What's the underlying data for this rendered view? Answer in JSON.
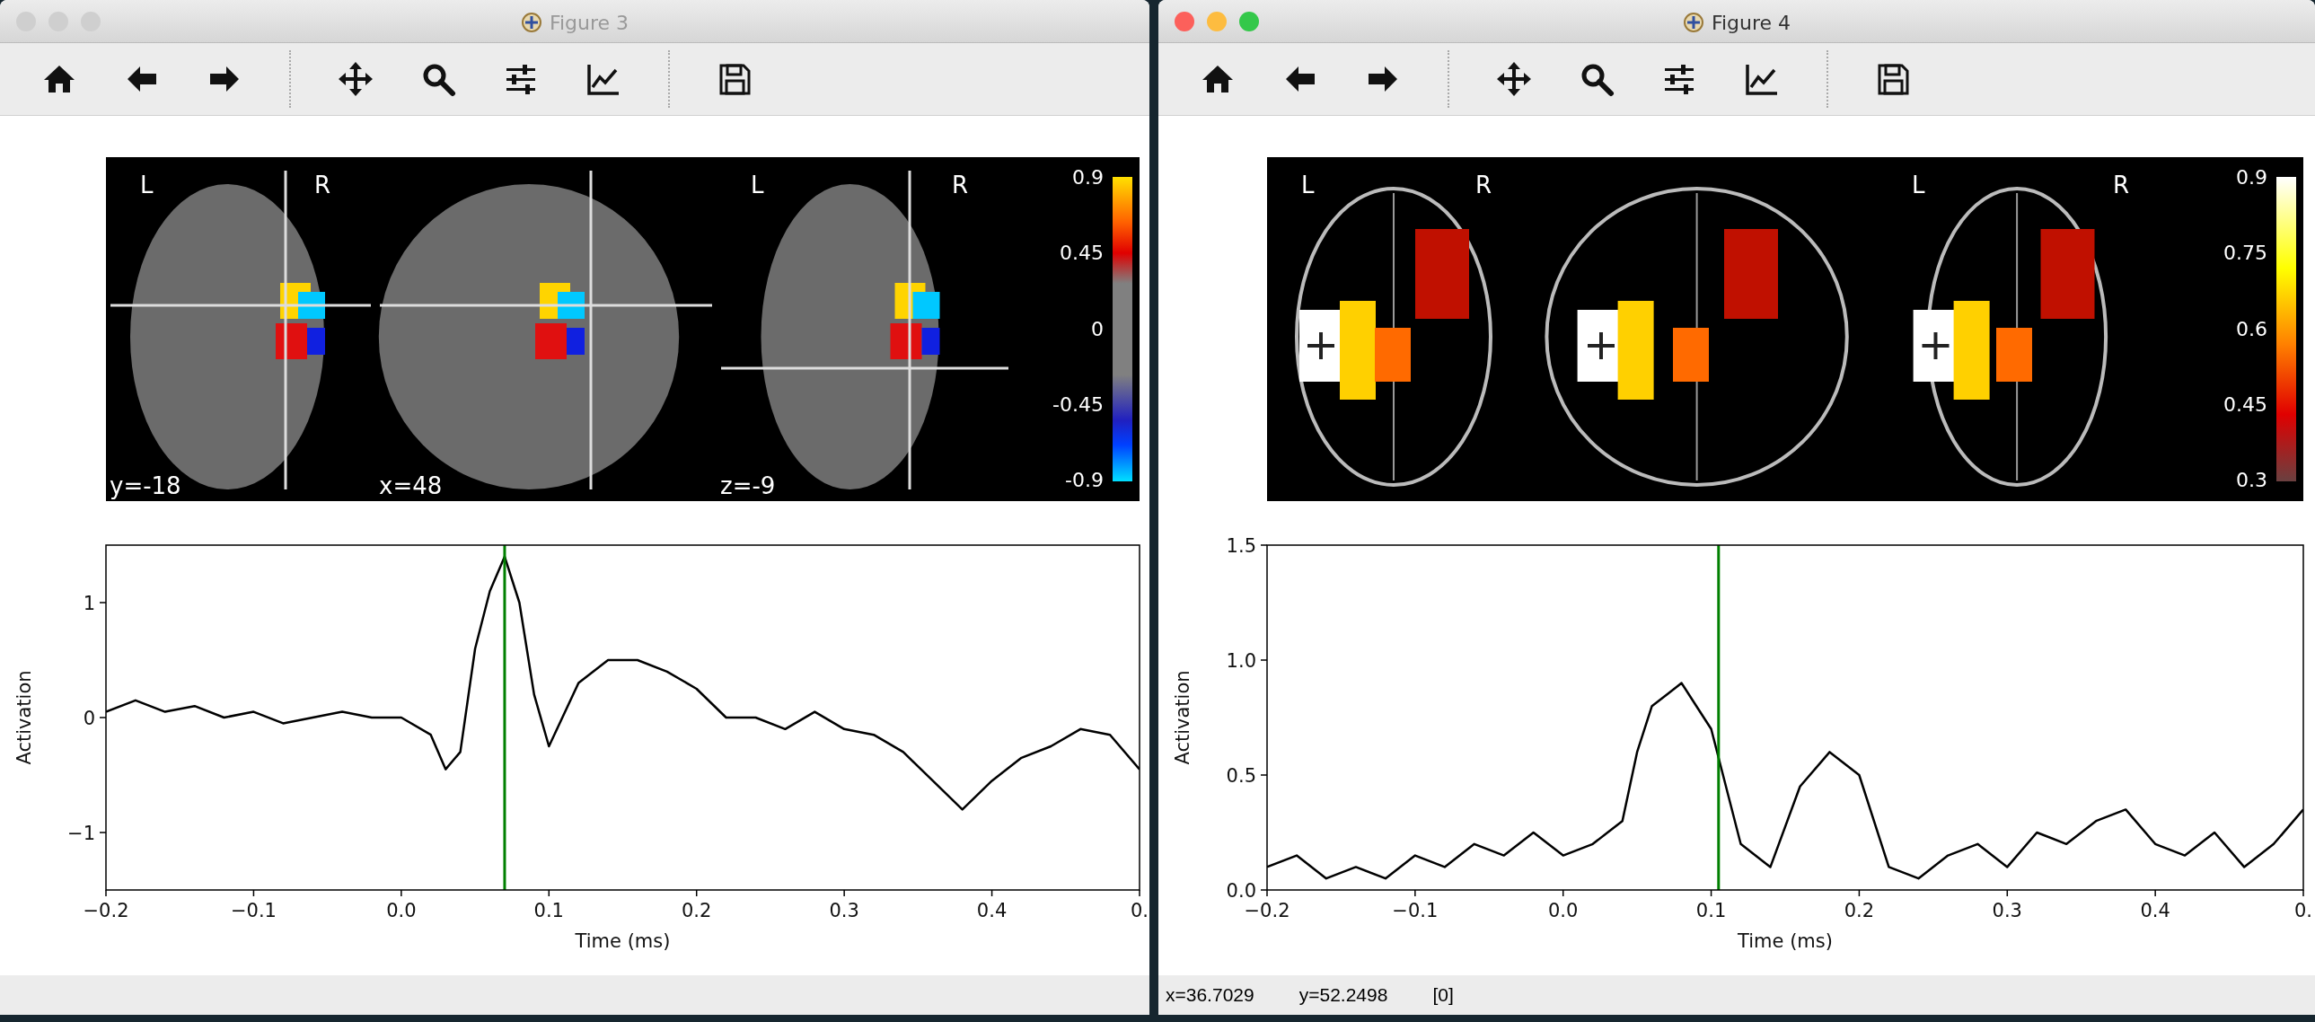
{
  "windows": [
    {
      "title": "Figure 3",
      "active": false,
      "toolbar": [
        {
          "kind": "home"
        },
        {
          "kind": "back"
        },
        {
          "kind": "forward"
        },
        {
          "kind": "separator"
        },
        {
          "kind": "pan"
        },
        {
          "kind": "zoom"
        },
        {
          "kind": "subplots"
        },
        {
          "kind": "axes"
        },
        {
          "kind": "separator"
        },
        {
          "kind": "save"
        }
      ],
      "brain_view": {
        "kind": "slices",
        "views": [
          {
            "kind": "coronal",
            "left": "L",
            "right": "R",
            "coord": "y=-18"
          },
          {
            "kind": "sagittal",
            "coord": "x=48"
          },
          {
            "kind": "axial",
            "left": "L",
            "right": "R",
            "coord": "z=-9"
          }
        ],
        "colorbar_ticks": [
          "0.9",
          "0.45",
          "0",
          "-0.45",
          "-0.9"
        ]
      },
      "plot": {
        "chart_data": {
          "type": "line",
          "xlabel": "Time (ms)",
          "ylabel": "Activation",
          "xlim": [
            -0.2,
            0.5
          ],
          "ylim": [
            -1.5,
            1.5
          ],
          "xticks": [
            {
              "value": -0.2,
              "label": "−0.2"
            },
            {
              "value": -0.1,
              "label": "−0.1"
            },
            {
              "value": 0,
              "label": "0.0"
            },
            {
              "value": 0.1,
              "label": "0.1"
            },
            {
              "value": 0.2,
              "label": "0.2"
            },
            {
              "value": 0.3,
              "label": "0.3"
            },
            {
              "value": 0.4,
              "label": "0.4"
            },
            {
              "value": 0.5,
              "label": "0."
            }
          ],
          "yticks": [
            {
              "value": -1,
              "label": "−1"
            },
            {
              "value": 0,
              "label": "0"
            },
            {
              "value": 1,
              "label": "1"
            }
          ],
          "x": [
            -0.2,
            -0.18,
            -0.16,
            -0.14,
            -0.12,
            -0.1,
            -0.08,
            -0.06,
            -0.04,
            -0.02,
            0,
            0.02,
            0.03,
            0.04,
            0.05,
            0.06,
            0.07,
            0.08,
            0.09,
            0.1,
            0.12,
            0.14,
            0.16,
            0.18,
            0.2,
            0.22,
            0.24,
            0.26,
            0.28,
            0.3,
            0.32,
            0.34,
            0.36,
            0.38,
            0.4,
            0.42,
            0.44,
            0.46,
            0.48,
            0.5
          ],
          "series": [
            {
              "color": "#000000",
              "values": [
                0.05,
                0.15,
                0.05,
                0.1,
                0.0,
                0.05,
                -0.05,
                0.0,
                0.05,
                0.0,
                0.0,
                -0.15,
                -0.45,
                -0.3,
                0.6,
                1.1,
                1.4,
                1.0,
                0.2,
                -0.25,
                0.3,
                0.5,
                0.5,
                0.4,
                0.25,
                0.0,
                0.0,
                -0.1,
                0.05,
                -0.1,
                -0.15,
                -0.3,
                -0.55,
                -0.8,
                -0.55,
                -0.35,
                -0.25,
                -0.1,
                -0.15,
                -0.45
              ]
            }
          ],
          "ref_lines": [
            {
              "axis": "x",
              "value": 0.07,
              "color": "#008000"
            }
          ]
        }
      }
    },
    {
      "title": "Figure 4",
      "active": true,
      "toolbar": [
        {
          "kind": "home"
        },
        {
          "kind": "back"
        },
        {
          "kind": "forward"
        },
        {
          "kind": "separator"
        },
        {
          "kind": "pan"
        },
        {
          "kind": "zoom"
        },
        {
          "kind": "subplots"
        },
        {
          "kind": "axes"
        },
        {
          "kind": "separator"
        },
        {
          "kind": "save"
        }
      ],
      "brain_view": {
        "kind": "glass",
        "views": [
          {
            "kind": "coronal",
            "left": "L",
            "right": "R"
          },
          {
            "kind": "sagittal"
          },
          {
            "kind": "axial",
            "left": "L",
            "right": "R"
          }
        ],
        "colorbar_ticks": [
          "0.9",
          "0.75",
          "0.6",
          "0.45",
          "0.3"
        ]
      },
      "plot": {
        "chart_data": {
          "type": "line",
          "xlabel": "Time (ms)",
          "ylabel": "Activation",
          "xlim": [
            -0.2,
            0.5
          ],
          "ylim": [
            0,
            1.5
          ],
          "xticks": [
            {
              "value": -0.2,
              "label": "−0.2"
            },
            {
              "value": -0.1,
              "label": "−0.1"
            },
            {
              "value": 0,
              "label": "0.0"
            },
            {
              "value": 0.1,
              "label": "0.1"
            },
            {
              "value": 0.2,
              "label": "0.2"
            },
            {
              "value": 0.3,
              "label": "0.3"
            },
            {
              "value": 0.4,
              "label": "0.4"
            },
            {
              "value": 0.5,
              "label": "0."
            }
          ],
          "yticks": [
            {
              "value": 0,
              "label": "0.0"
            },
            {
              "value": 0.5,
              "label": "0.5"
            },
            {
              "value": 1,
              "label": "1.0"
            },
            {
              "value": 1.5,
              "label": "1.5"
            }
          ],
          "x": [
            -0.2,
            -0.18,
            -0.16,
            -0.14,
            -0.12,
            -0.1,
            -0.08,
            -0.06,
            -0.04,
            -0.02,
            0,
            0.02,
            0.03,
            0.04,
            0.05,
            0.06,
            0.07,
            0.08,
            0.09,
            0.1,
            0.12,
            0.14,
            0.16,
            0.18,
            0.2,
            0.22,
            0.24,
            0.26,
            0.28,
            0.3,
            0.32,
            0.34,
            0.36,
            0.38,
            0.4,
            0.42,
            0.44,
            0.46,
            0.48,
            0.5
          ],
          "series": [
            {
              "color": "#000000",
              "values": [
                0.1,
                0.15,
                0.05,
                0.1,
                0.05,
                0.15,
                0.1,
                0.2,
                0.15,
                0.25,
                0.15,
                0.2,
                0.25,
                0.3,
                0.6,
                0.8,
                0.85,
                0.9,
                0.8,
                0.7,
                0.2,
                0.1,
                0.45,
                0.6,
                0.5,
                0.1,
                0.05,
                0.15,
                0.2,
                0.1,
                0.25,
                0.2,
                0.3,
                0.35,
                0.2,
                0.15,
                0.25,
                0.1,
                0.2,
                0.35
              ]
            }
          ],
          "ref_lines": [
            {
              "axis": "x",
              "value": 0.105,
              "color": "#008000"
            }
          ]
        }
      },
      "status": [
        "x=36.7029",
        "y=52.2498",
        "[0]"
      ]
    }
  ]
}
